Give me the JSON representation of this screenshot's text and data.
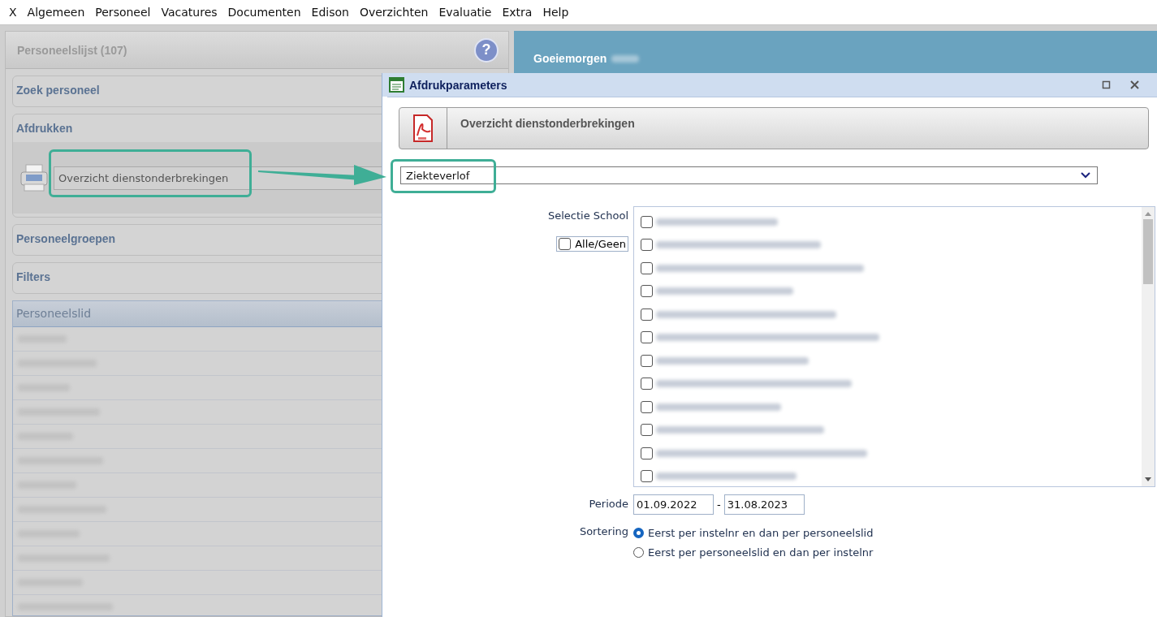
{
  "menu": [
    {
      "label": "X"
    },
    {
      "label": "Algemeen"
    },
    {
      "label": "Personeel"
    },
    {
      "label": "Vacatures"
    },
    {
      "label": "Documenten"
    },
    {
      "label": "Edison"
    },
    {
      "label": "Overzichten"
    },
    {
      "label": "Evaluatie"
    },
    {
      "label": "Extra"
    },
    {
      "label": "Help"
    }
  ],
  "left_panel": {
    "title": "Personeelslijst (107)",
    "help": "?",
    "sections": [
      {
        "kind": "plain",
        "title": "Zoek personeel"
      },
      {
        "kind": "print",
        "title": "Afdrukken",
        "select_value": "Overzicht dienstonderbrekingen"
      },
      {
        "kind": "plain",
        "title": "Personeelgroepen"
      },
      {
        "kind": "plain",
        "title": "Filters"
      }
    ],
    "table": {
      "column": "Personeelslid",
      "rows": [
        {
          "kind": "blurred"
        },
        {
          "kind": "blurred"
        },
        {
          "kind": "blurred"
        },
        {
          "kind": "blurred"
        },
        {
          "kind": "blurred"
        },
        {
          "kind": "blurred"
        },
        {
          "kind": "blurred"
        },
        {
          "kind": "blurred"
        },
        {
          "kind": "blurred"
        },
        {
          "kind": "blurred"
        },
        {
          "kind": "blurred"
        },
        {
          "kind": "blurred"
        }
      ]
    }
  },
  "right_panel": {
    "greeting": "Goeiemorgen"
  },
  "dialog": {
    "title": "Afdrukparameters",
    "report_title": "Overzicht dienstonderbrekingen",
    "type_select": "Ziekteverlof",
    "school_label": "Selectie School",
    "all_none": {
      "label": "Alle/Geen",
      "checked": false
    },
    "schools": [
      {
        "checked": false
      },
      {
        "checked": false
      },
      {
        "checked": false
      },
      {
        "checked": false
      },
      {
        "checked": false
      },
      {
        "checked": false
      },
      {
        "checked": false
      },
      {
        "checked": false
      },
      {
        "checked": false
      },
      {
        "checked": false
      },
      {
        "checked": false
      },
      {
        "checked": false
      }
    ],
    "period_label": "Periode",
    "period_from": "01.09.2022",
    "period_separator": "-",
    "period_to": "31.08.2023",
    "sort_label": "Sortering",
    "sort_options": [
      {
        "label": "Eerst per instelnr en dan per personeelslid",
        "selected": true
      },
      {
        "label": "Eerst per personeelslid en dan per instelnr",
        "selected": false
      }
    ]
  }
}
